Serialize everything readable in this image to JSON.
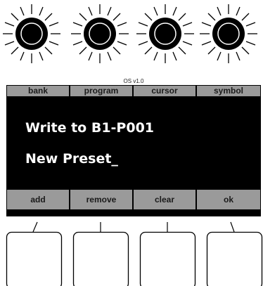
{
  "os_version": "OS v1.0",
  "top_tabs": [
    "bank",
    "program",
    "cursor",
    "symbol"
  ],
  "display": {
    "line1": "Write to B1-P001",
    "line2": "New Preset_"
  },
  "bottom_buttons": [
    "add",
    "remove",
    "clear",
    "ok"
  ],
  "knob_icon": "rotary-encoder-knob",
  "hardware_button_icon": "square-button"
}
